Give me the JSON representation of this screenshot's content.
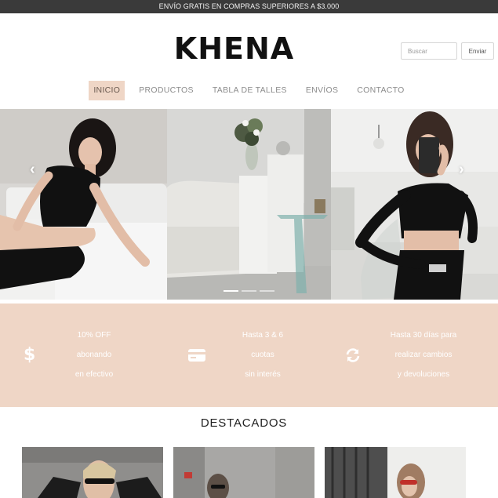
{
  "announcement": "ENVÍO GRATIS EN COMPRAS SUPERIORES A $3.000",
  "brand": {
    "logo_text": "KHENA"
  },
  "search": {
    "placeholder": "Buscar",
    "button_label": "Enviar"
  },
  "nav": {
    "items": [
      {
        "label": "INICIO",
        "active": true
      },
      {
        "label": "PRODUCTOS"
      },
      {
        "label": "TABLA DE TALLES"
      },
      {
        "label": "ENVÍOS"
      },
      {
        "label": "CONTACTO"
      }
    ]
  },
  "slider": {
    "prev_icon": "chevron-left-icon",
    "next_icon": "chevron-right-icon",
    "slides": 3,
    "active_slide": 1
  },
  "benefits": [
    {
      "icon": "dollar-icon",
      "lines": [
        "10% OFF",
        "abonando",
        "en efectivo"
      ]
    },
    {
      "icon": "credit-card-icon",
      "lines": [
        "Hasta 3 & 6",
        "cuotas",
        "sin interés"
      ]
    },
    {
      "icon": "exchange-icon",
      "lines": [
        "Hasta 30 días para",
        "realizar cambios",
        "y devoluciones"
      ]
    }
  ],
  "featured": {
    "title": "DESTACADOS"
  },
  "colors": {
    "accent": "#efd6c6",
    "topbar": "#3a3a3a"
  }
}
